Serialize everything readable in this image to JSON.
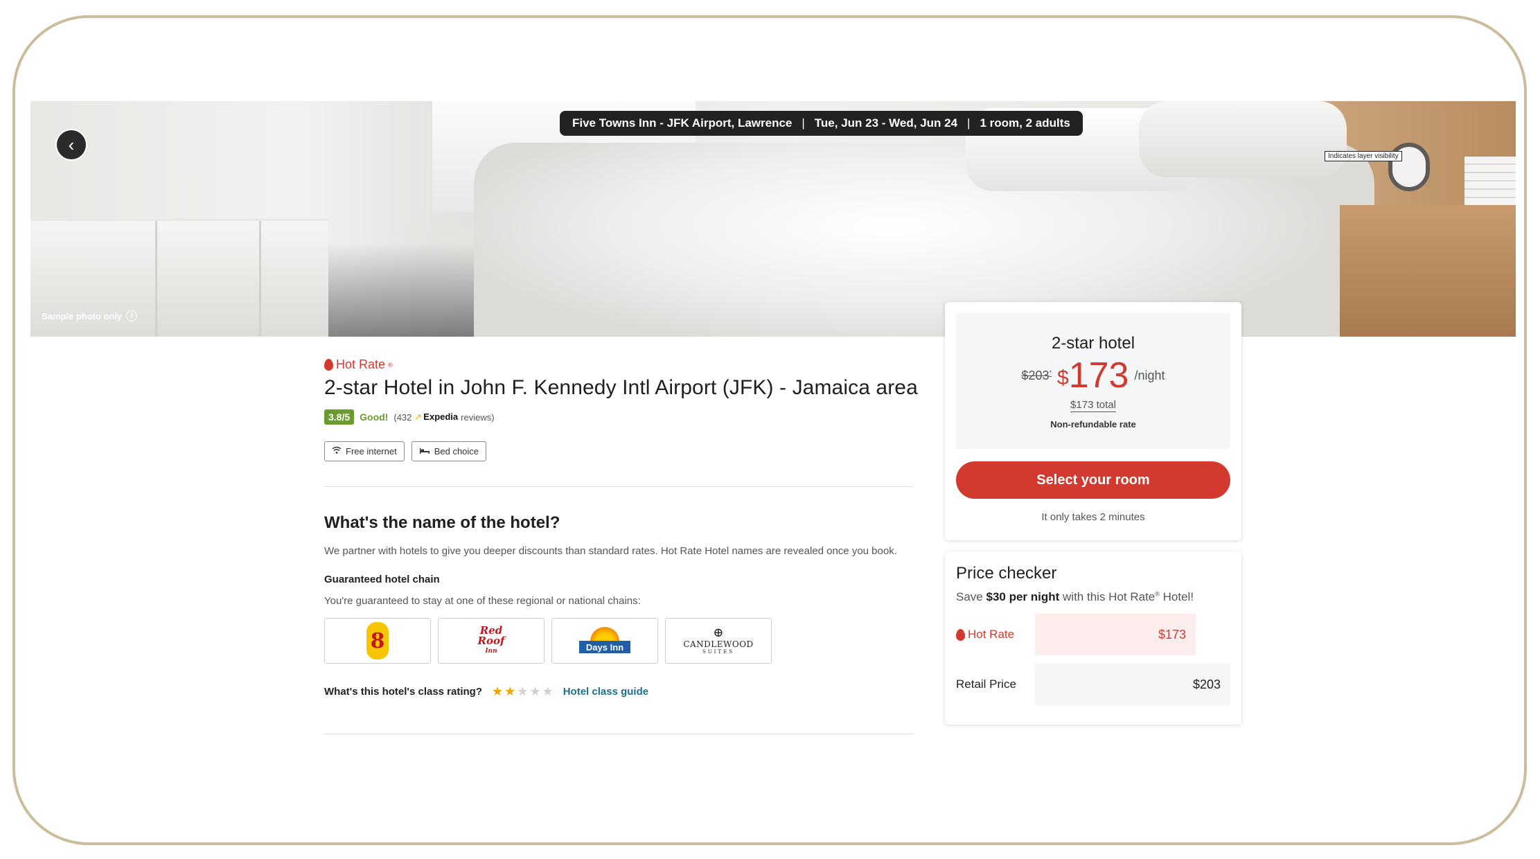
{
  "hero": {
    "back_icon": "chevron-left-icon",
    "trip": {
      "hotel_area": "Five Towns Inn - JFK Airport, Lawrence",
      "dates": "Tue, Jun 23 - Wed, Jun 24",
      "guests": "1 room, 2 adults",
      "separator": "|"
    },
    "layer_tooltip": "Indicates layer visibility",
    "sample_photo": "Sample photo only",
    "info_icon": "i"
  },
  "hotel": {
    "hot_rate_label": "Hot Rate",
    "trademark": "®",
    "title": "2-star Hotel in John F. Kennedy Intl Airport (JFK) - Jamaica area",
    "rating": {
      "score": "3.8/5",
      "word": "Good!",
      "reviews_prefix": "(432",
      "provider": "Expedia",
      "reviews_suffix": "reviews)"
    },
    "amenities": [
      {
        "icon": "wifi-icon",
        "label": "Free internet"
      },
      {
        "icon": "bed-icon",
        "label": "Bed choice"
      }
    ]
  },
  "name_section": {
    "title": "What's the name of the hotel?",
    "description": "We partner with hotels to give you deeper discounts than standard rates. Hot Rate Hotel names are revealed once you book.",
    "chain_title": "Guaranteed hotel chain",
    "chain_description": "You're guaranteed to stay at one of these regional or national chains:",
    "chains": [
      {
        "name": "Super 8",
        "logo_text": "8"
      },
      {
        "name": "Red Roof Inn",
        "logo_text_1": "Red",
        "logo_text_2": "Roof",
        "logo_text_3": "Inn"
      },
      {
        "name": "Days Inn",
        "logo_text": "Days Inn"
      },
      {
        "name": "Candlewood Suites",
        "logo_text": "CANDLEWOOD",
        "logo_sub": "SUITES"
      }
    ],
    "class_question": "What's this hotel's class rating?",
    "class_stars": 2,
    "class_stars_max": 5,
    "class_guide_link": "Hotel class guide"
  },
  "price_card": {
    "star_class": "2-star hotel",
    "old_price": "$203",
    "old_price_mark": "*",
    "currency": "$",
    "new_price": "173",
    "per_night": "/night",
    "total": "$173 total",
    "non_refundable": "Non-refundable rate",
    "select_button": "Select your room",
    "takes": "It only takes 2 minutes"
  },
  "price_checker": {
    "title": "Price checker",
    "sub_prefix": "Save",
    "sub_bold": "$30 per night",
    "sub_mid": "with this Hot Rate",
    "sub_reg": "®",
    "sub_suffix": "Hotel!",
    "rows": [
      {
        "label": "Hot Rate",
        "value": "$173"
      },
      {
        "label": "Retail Price",
        "value": "$203"
      }
    ]
  },
  "colors": {
    "accent_red": "#d23a2f",
    "rating_green": "#6b9b2e",
    "link_teal": "#1f6f8b",
    "star_gold": "#f0a400"
  }
}
